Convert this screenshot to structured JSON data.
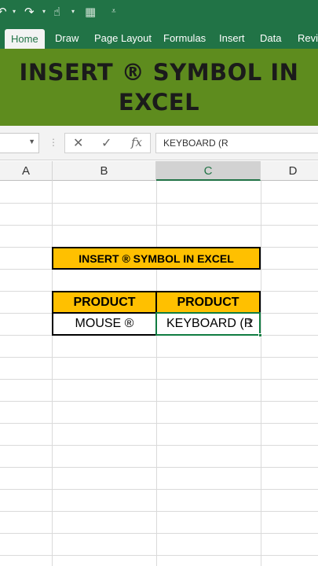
{
  "quick_access": {
    "undo_icon": "undo-icon",
    "redo_icon": "redo-icon",
    "touch_icon": "touch-mode-icon",
    "form_icon": "form-icon",
    "customize_icon": "customize-icon"
  },
  "ribbon": {
    "tabs": [
      {
        "label": "Home",
        "active": true
      },
      {
        "label": "Draw",
        "active": false
      },
      {
        "label": "Page Layout",
        "active": false
      },
      {
        "label": "Formulas",
        "active": false
      },
      {
        "label": "Insert",
        "active": false
      },
      {
        "label": "Data",
        "active": false
      },
      {
        "label": "Revie",
        "active": false
      }
    ]
  },
  "banner": {
    "title": "INSERT ® SYMBOL IN EXCEL"
  },
  "formula_bar": {
    "name_box": "",
    "cancel_glyph": "✕",
    "enter_glyph": "✓",
    "fx_label": "fx",
    "formula": "KEYBOARD (R"
  },
  "grid": {
    "columns": [
      "A",
      "B",
      "C",
      "D"
    ],
    "selected_column": "C",
    "title_cell": "INSERT ® SYMBOL IN EXCEL",
    "header_b": "PRODUCT",
    "header_c": "PRODUCT",
    "value_b": "MOUSE ®",
    "value_c": "KEYBOARD (R"
  },
  "colors": {
    "excel_green": "#217346",
    "banner_green": "#5e8c1e",
    "header_fill": "#ffc000",
    "active_cell_border": "#107c41"
  }
}
